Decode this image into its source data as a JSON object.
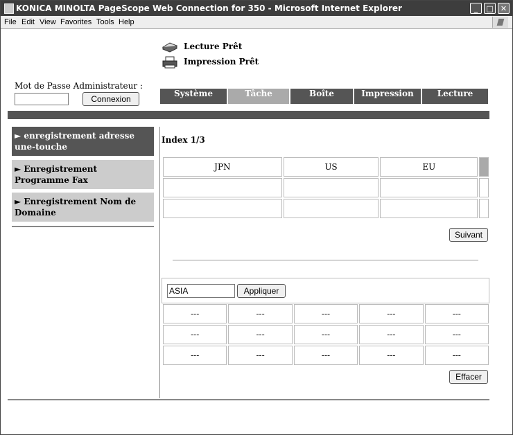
{
  "window": {
    "title": "KONICA MINOLTA PageScope Web Connection for 350 - Microsoft Internet Explorer",
    "controls": {
      "minimize": "_",
      "maximize": "□",
      "close": "✕"
    }
  },
  "menu": [
    "File",
    "Edit",
    "View",
    "Favorites",
    "Tools",
    "Help"
  ],
  "status": {
    "scan": "Lecture Prêt",
    "print": "Impression Prêt"
  },
  "login": {
    "label": "Mot de Passe Administrateur :",
    "password": "",
    "button": "Connexion"
  },
  "tabs": [
    {
      "label": "Système",
      "active": false
    },
    {
      "label": "Tâche",
      "active": true
    },
    {
      "label": "Boîte",
      "active": false
    },
    {
      "label": "Impression",
      "active": false
    },
    {
      "label": "Lecture",
      "active": false
    }
  ],
  "sidebar": [
    {
      "label": "► enregistrement adresse une-touche",
      "active": true
    },
    {
      "label": "► Enregistrement Programme Fax",
      "active": false
    },
    {
      "label": "► Enregistrement Nom de Domaine",
      "active": false
    }
  ],
  "index_label": "Index 1/3",
  "regions": [
    [
      "JPN",
      "US",
      "EU",
      ""
    ],
    [
      "",
      "",
      "",
      ""
    ],
    [
      "",
      "",
      "",
      ""
    ]
  ],
  "next_button": "Suivant",
  "region_input": {
    "value": "ASIA"
  },
  "apply_button": "Appliquer",
  "entries": [
    [
      "---",
      "---",
      "---",
      "---",
      "---"
    ],
    [
      "---",
      "---",
      "---",
      "---",
      "---"
    ],
    [
      "---",
      "---",
      "---",
      "---",
      "---"
    ]
  ],
  "clear_button": "Effacer",
  "colors": {
    "titlebar": "#3d3d3d",
    "tab": "#555555",
    "tab_active": "#aaaaaa",
    "sidebar_active": "#555555",
    "sidebar": "#cccccc",
    "selected_cell": "#aaaaaa"
  }
}
